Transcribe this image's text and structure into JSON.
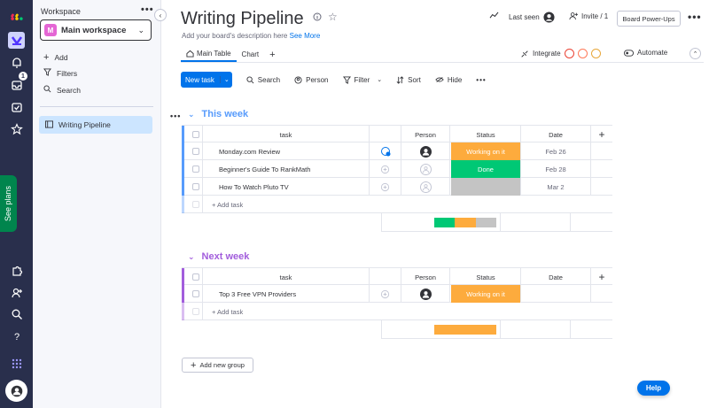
{
  "sidebar": {
    "workspace_label": "Workspace",
    "workspace_name": "Main workspace",
    "workspace_initial": "M",
    "items": [
      {
        "label": "Add",
        "icon": "plus-icon"
      },
      {
        "label": "Filters",
        "icon": "filter-icon"
      },
      {
        "label": "Search",
        "icon": "search-icon"
      }
    ],
    "board": "Writing Pipeline"
  },
  "rail": {
    "inbox_badge": "1",
    "see_plans": "See plans"
  },
  "header": {
    "title": "Writing Pipeline",
    "description": "Add your board's description here",
    "see_more": "See More",
    "last_seen": "Last seen",
    "invite": "Invite / 1",
    "power_ups": "Board Power-Ups"
  },
  "tabs": [
    {
      "label": "Main Table",
      "active": true
    },
    {
      "label": "Chart",
      "active": false
    }
  ],
  "tab_add": "+",
  "integrate": "Integrate",
  "automate": "Automate",
  "toolbar": {
    "new_task": "New task",
    "search": "Search",
    "person": "Person",
    "filter": "Filter",
    "sort": "Sort",
    "hide": "Hide"
  },
  "columns": {
    "task": "task",
    "person": "Person",
    "status": "Status",
    "date": "Date"
  },
  "groups": [
    {
      "name": "This week",
      "color": "#579bfc",
      "rows": [
        {
          "task": "Monday.com Review",
          "person": "filled",
          "status": "Working on it",
          "status_color": "#fdab3d",
          "date": "Feb 26"
        },
        {
          "task": "Beginner's Guide To RankMath",
          "person": "empty",
          "status": "Done",
          "status_color": "#00c875",
          "date": "Feb 28"
        },
        {
          "task": "How To Watch Pluto TV",
          "person": "empty",
          "status": "",
          "status_color": "#c4c4c4",
          "date": "Mar 2"
        }
      ],
      "add_label": "+ Add task",
      "summary": [
        {
          "color": "#00c875",
          "fraction": 0.333
        },
        {
          "color": "#fdab3d",
          "fraction": 0.333
        },
        {
          "color": "#c4c4c4",
          "fraction": 0.334
        }
      ]
    },
    {
      "name": "Next week",
      "color": "#a25ddc",
      "rows": [
        {
          "task": "Top 3 Free VPN Providers",
          "person": "filled",
          "status": "Working on it",
          "status_color": "#fdab3d",
          "date": ""
        }
      ],
      "add_label": "+ Add task",
      "summary": [
        {
          "color": "#fdab3d",
          "fraction": 1.0
        }
      ]
    }
  ],
  "add_new_group": "Add new group",
  "help": "Help"
}
